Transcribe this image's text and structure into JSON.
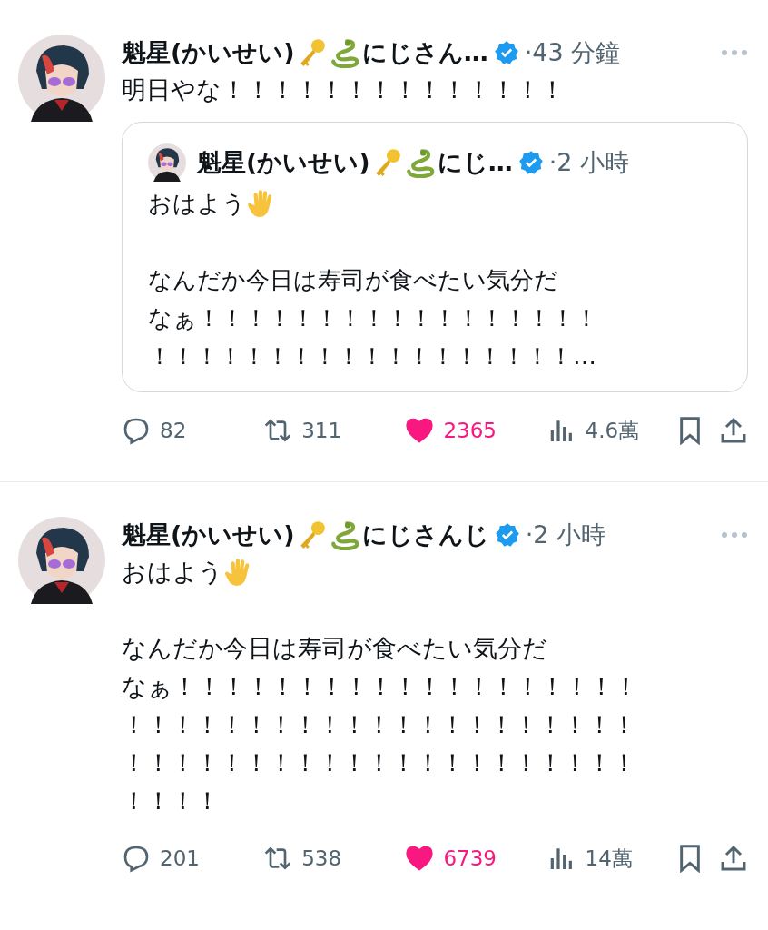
{
  "posts": [
    {
      "name": "魁星(かいせい)",
      "name_suffix": "にじさん…",
      "verified": true,
      "time": "·43 分鐘",
      "lines": [
        {
          "kind": "text",
          "text": "明日やな！！！！！！！！！！！！！！"
        }
      ],
      "quote": {
        "name": "魁星(かいせい)",
        "name_suffix": "にじ…",
        "verified": true,
        "time": "·2 小時",
        "lines": [
          {
            "kind": "hand",
            "text": "おはよう"
          },
          {
            "kind": "blank"
          },
          {
            "kind": "text",
            "text": "なんだか今日は寿司が食べたい気分だ"
          },
          {
            "kind": "text",
            "text": "なぁ！！！！！！！！！！！！！！！！！"
          },
          {
            "kind": "text",
            "text": "！！！！！！！！！！！！！！！！！！…"
          }
        ]
      },
      "stats": {
        "replies": "82",
        "reposts": "311",
        "likes": "2365",
        "liked": true,
        "views": "4.6萬"
      }
    },
    {
      "name": "魁星(かいせい)",
      "name_suffix": "にじさんじ",
      "verified": true,
      "time": "·2 小時",
      "lines": [
        {
          "kind": "hand",
          "text": "おはよう"
        },
        {
          "kind": "blank"
        },
        {
          "kind": "text",
          "text": "なんだか今日は寿司が食べたい気分だ"
        },
        {
          "kind": "text",
          "text": "なぁ！！！！！！！！！！！！！！！！！！！"
        },
        {
          "kind": "text",
          "text": "！！！！！！！！！！！！！！！！！！！！！"
        },
        {
          "kind": "text",
          "text": "！！！！！！！！！！！！！！！！！！！！！"
        },
        {
          "kind": "text",
          "text": "！！！！"
        }
      ],
      "stats": {
        "replies": "201",
        "reposts": "538",
        "likes": "6739",
        "liked": true,
        "views": "14萬"
      }
    }
  ]
}
